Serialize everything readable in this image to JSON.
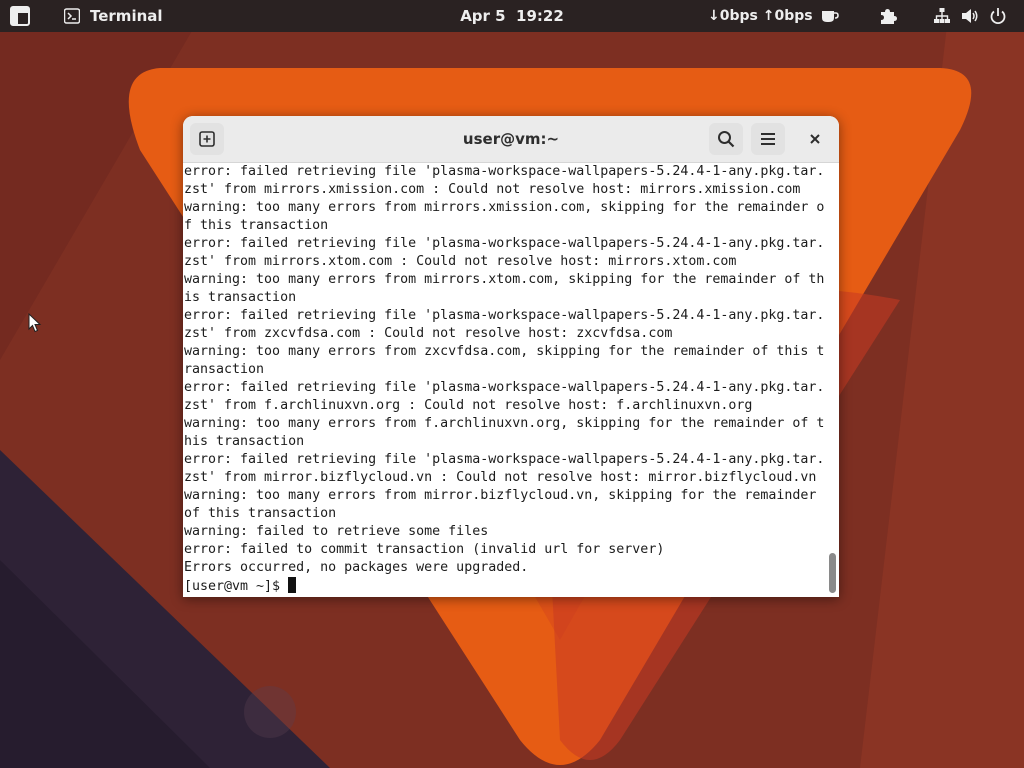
{
  "topbar": {
    "app_name": "Terminal",
    "clock": "Apr 5  19:22",
    "net_speed": "↓0bps ↑0bps"
  },
  "window": {
    "title": "user@vm:~",
    "lines": [
      "error: failed retrieving file 'plasma-workspace-wallpapers-5.24.4-1-any.pkg.tar.",
      "zst' from mirrors.xmission.com : Could not resolve host: mirrors.xmission.com",
      "warning: too many errors from mirrors.xmission.com, skipping for the remainder o",
      "f this transaction",
      "error: failed retrieving file 'plasma-workspace-wallpapers-5.24.4-1-any.pkg.tar.",
      "zst' from mirrors.xtom.com : Could not resolve host: mirrors.xtom.com",
      "warning: too many errors from mirrors.xtom.com, skipping for the remainder of th",
      "is transaction",
      "error: failed retrieving file 'plasma-workspace-wallpapers-5.24.4-1-any.pkg.tar.",
      "zst' from zxcvfdsa.com : Could not resolve host: zxcvfdsa.com",
      "warning: too many errors from zxcvfdsa.com, skipping for the remainder of this t",
      "ransaction",
      "error: failed retrieving file 'plasma-workspace-wallpapers-5.24.4-1-any.pkg.tar.",
      "zst' from f.archlinuxvn.org : Could not resolve host: f.archlinuxvn.org",
      "warning: too many errors from f.archlinuxvn.org, skipping for the remainder of t",
      "his transaction",
      "error: failed retrieving file 'plasma-workspace-wallpapers-5.24.4-1-any.pkg.tar.",
      "zst' from mirror.bizflycloud.vn : Could not resolve host: mirror.bizflycloud.vn",
      "warning: too many errors from mirror.bizflycloud.vn, skipping for the remainder",
      "of this transaction",
      "warning: failed to retrieve some files",
      "error: failed to commit transaction (invalid url for server)",
      "Errors occurred, no packages were upgraded."
    ],
    "prompt": "[user@vm ~]$ "
  },
  "icons": {
    "activities": "activities-grid-icon",
    "terminal_app": "terminal-app-icon",
    "coffee": "coffee-cup-icon",
    "extensions": "puzzle-piece-icon",
    "network": "network-wired-icon",
    "volume": "speaker-volume-icon",
    "power": "power-icon",
    "new_tab": "new-tab-icon",
    "search": "search-icon",
    "menu": "hamburger-menu-icon",
    "close": "close-icon"
  },
  "colors": {
    "wallpaper_base": "#7a2e22",
    "wallpaper_orange": "#e15a14",
    "topbar_bg": "#2a2222",
    "window_bg": "#ffffff",
    "headerbar_bg": "#ebebeb"
  }
}
